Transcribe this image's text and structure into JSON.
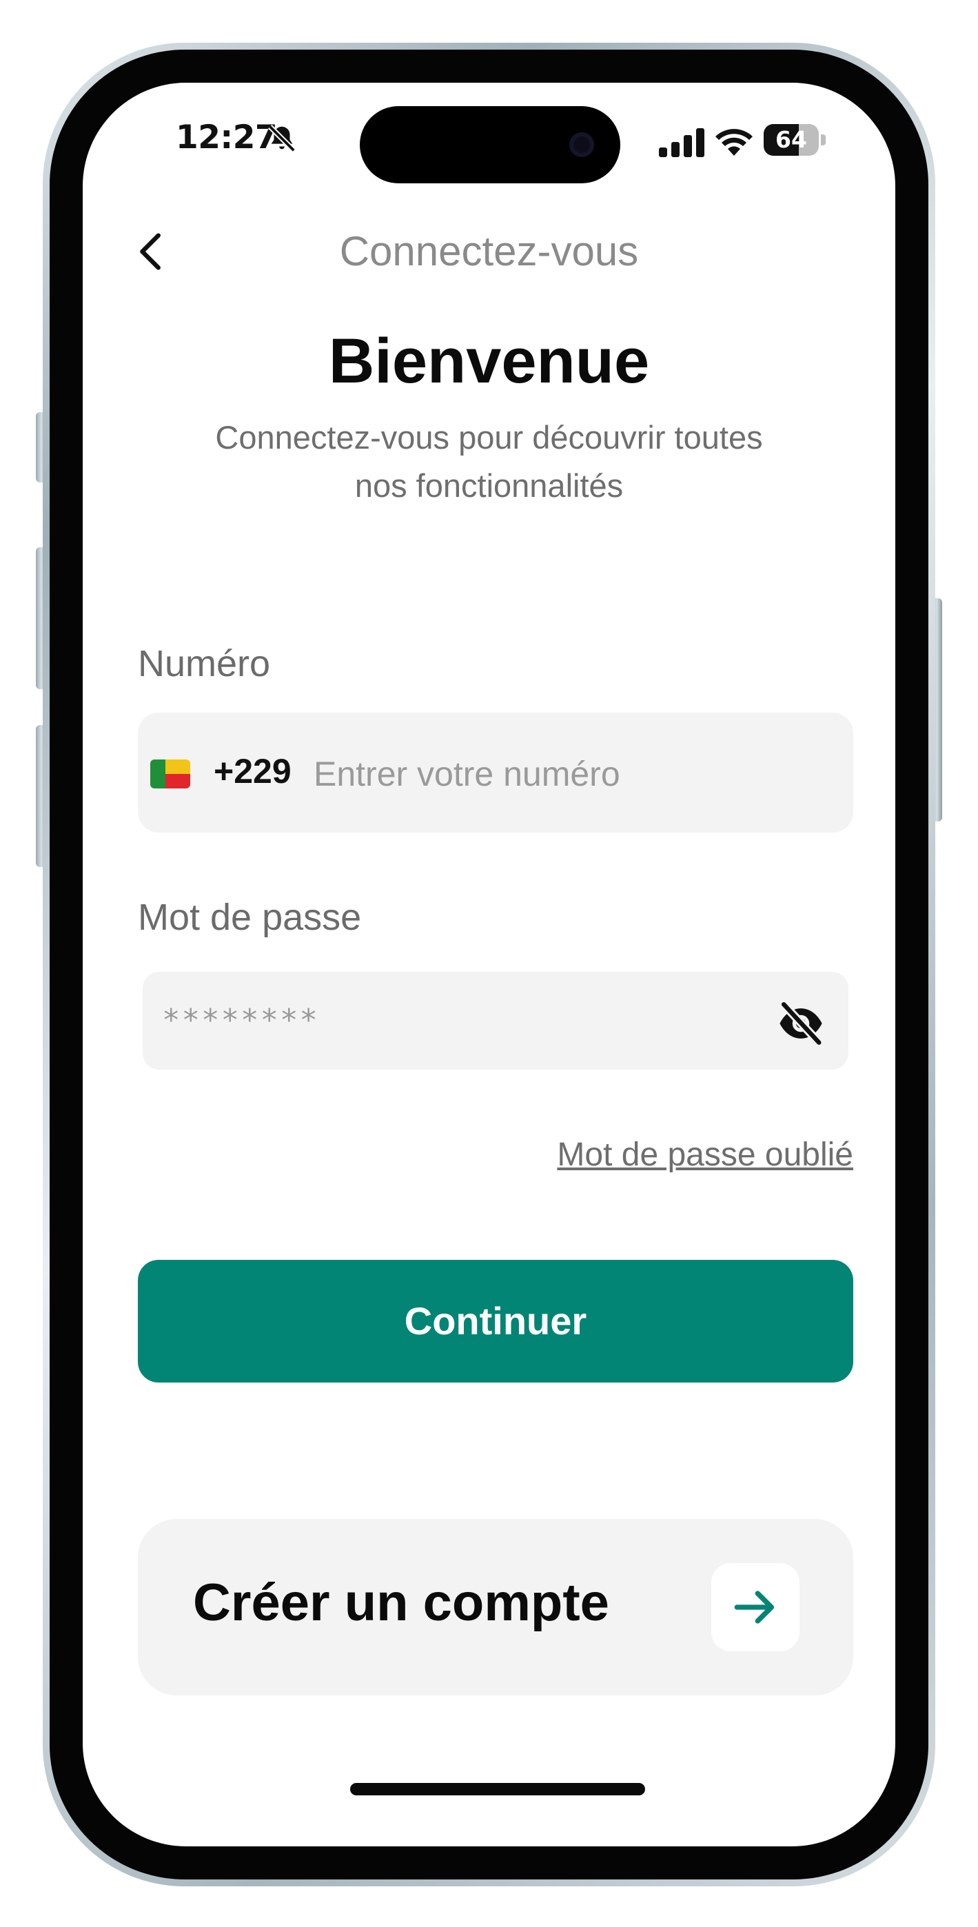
{
  "status_bar": {
    "time": "12:27",
    "battery": "64",
    "battery_level": 0.64,
    "icons": [
      "bell-slash-icon",
      "signal-icon",
      "wifi-icon",
      "battery-icon"
    ]
  },
  "header": {
    "back_icon": "chevron-left-icon",
    "title": "Connectez-vous"
  },
  "welcome": {
    "title": "Bienvenue",
    "subtitle": "Connectez-vous pour découvrir toutes nos fonctionnalités"
  },
  "form": {
    "phone": {
      "label": "Numéro",
      "country_code": "+229",
      "flag": "benin-flag-icon",
      "placeholder": "Entrer votre numéro",
      "value": ""
    },
    "password": {
      "label": "Mot de passe",
      "placeholder": "********",
      "value": "",
      "toggle_icon": "eye-slash-icon"
    },
    "forgot_label": "Mot de passe oublié",
    "submit_label": "Continuer"
  },
  "create_account": {
    "label": "Créer un compte",
    "icon": "arrow-right-icon"
  },
  "colors": {
    "primary": "#028574",
    "field_bg": "#f3f3f3",
    "muted_text": "#6e6e6e"
  }
}
